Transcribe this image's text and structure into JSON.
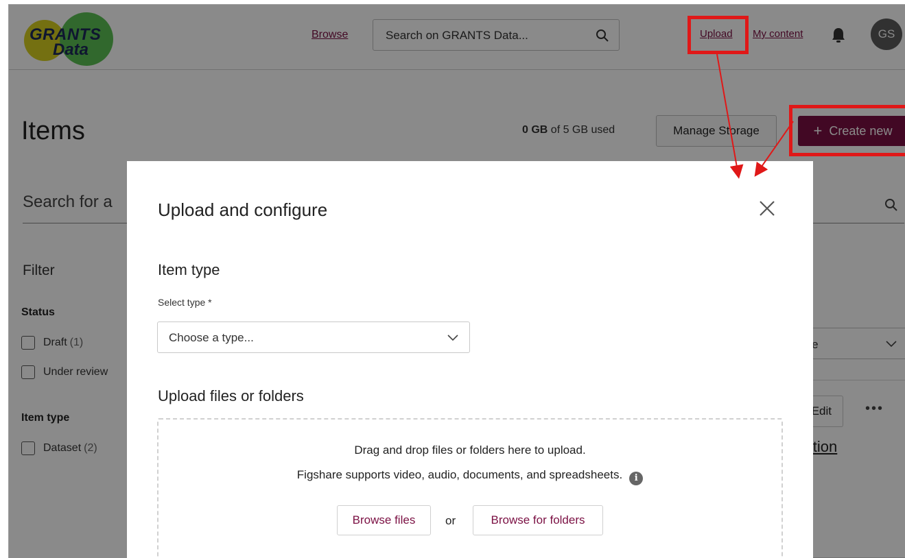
{
  "header": {
    "logo_line1": "GRANTS",
    "logo_line2": "Data",
    "browse_label": "Browse",
    "search_placeholder": "Search on GRANTS Data...",
    "upload_label": "Upload",
    "my_content_label": "My content",
    "avatar_initials": "GS"
  },
  "page": {
    "title": "Items",
    "usage_used": "0 GB",
    "usage_rest": " of 5 GB used",
    "manage_storage_label": "Manage Storage",
    "create_new_label": "Create new",
    "search_placeholder": "Search for a",
    "filter_heading": "Filter",
    "status_heading": "Status",
    "status_options": [
      {
        "label": "Draft",
        "count": "(1)"
      },
      {
        "label": "Under review",
        "count": ""
      }
    ],
    "item_type_heading": "Item type",
    "item_type_options": [
      {
        "label": "Dataset",
        "count": "(2)"
      }
    ],
    "sort_value": "ate",
    "edit_label": "Edit",
    "more_label": "•••",
    "item_title": "eration"
  },
  "modal": {
    "title": "Upload and configure",
    "item_type_heading": "Item type",
    "select_label": "Select type *",
    "select_value": "Choose a type...",
    "upload_heading": "Upload files or folders",
    "drop_text": "Drag and drop files or folders here to upload.",
    "supports_text": "Figshare supports video, audio, documents, and spreadsheets.",
    "info_glyph": "i",
    "browse_files_label": "Browse files",
    "or_label": "or",
    "browse_folders_label": "Browse for folders"
  },
  "colors": {
    "brand": "#7b1043",
    "annotation": "#e01818",
    "overlay": "rgba(0,0,0,0.46)"
  }
}
